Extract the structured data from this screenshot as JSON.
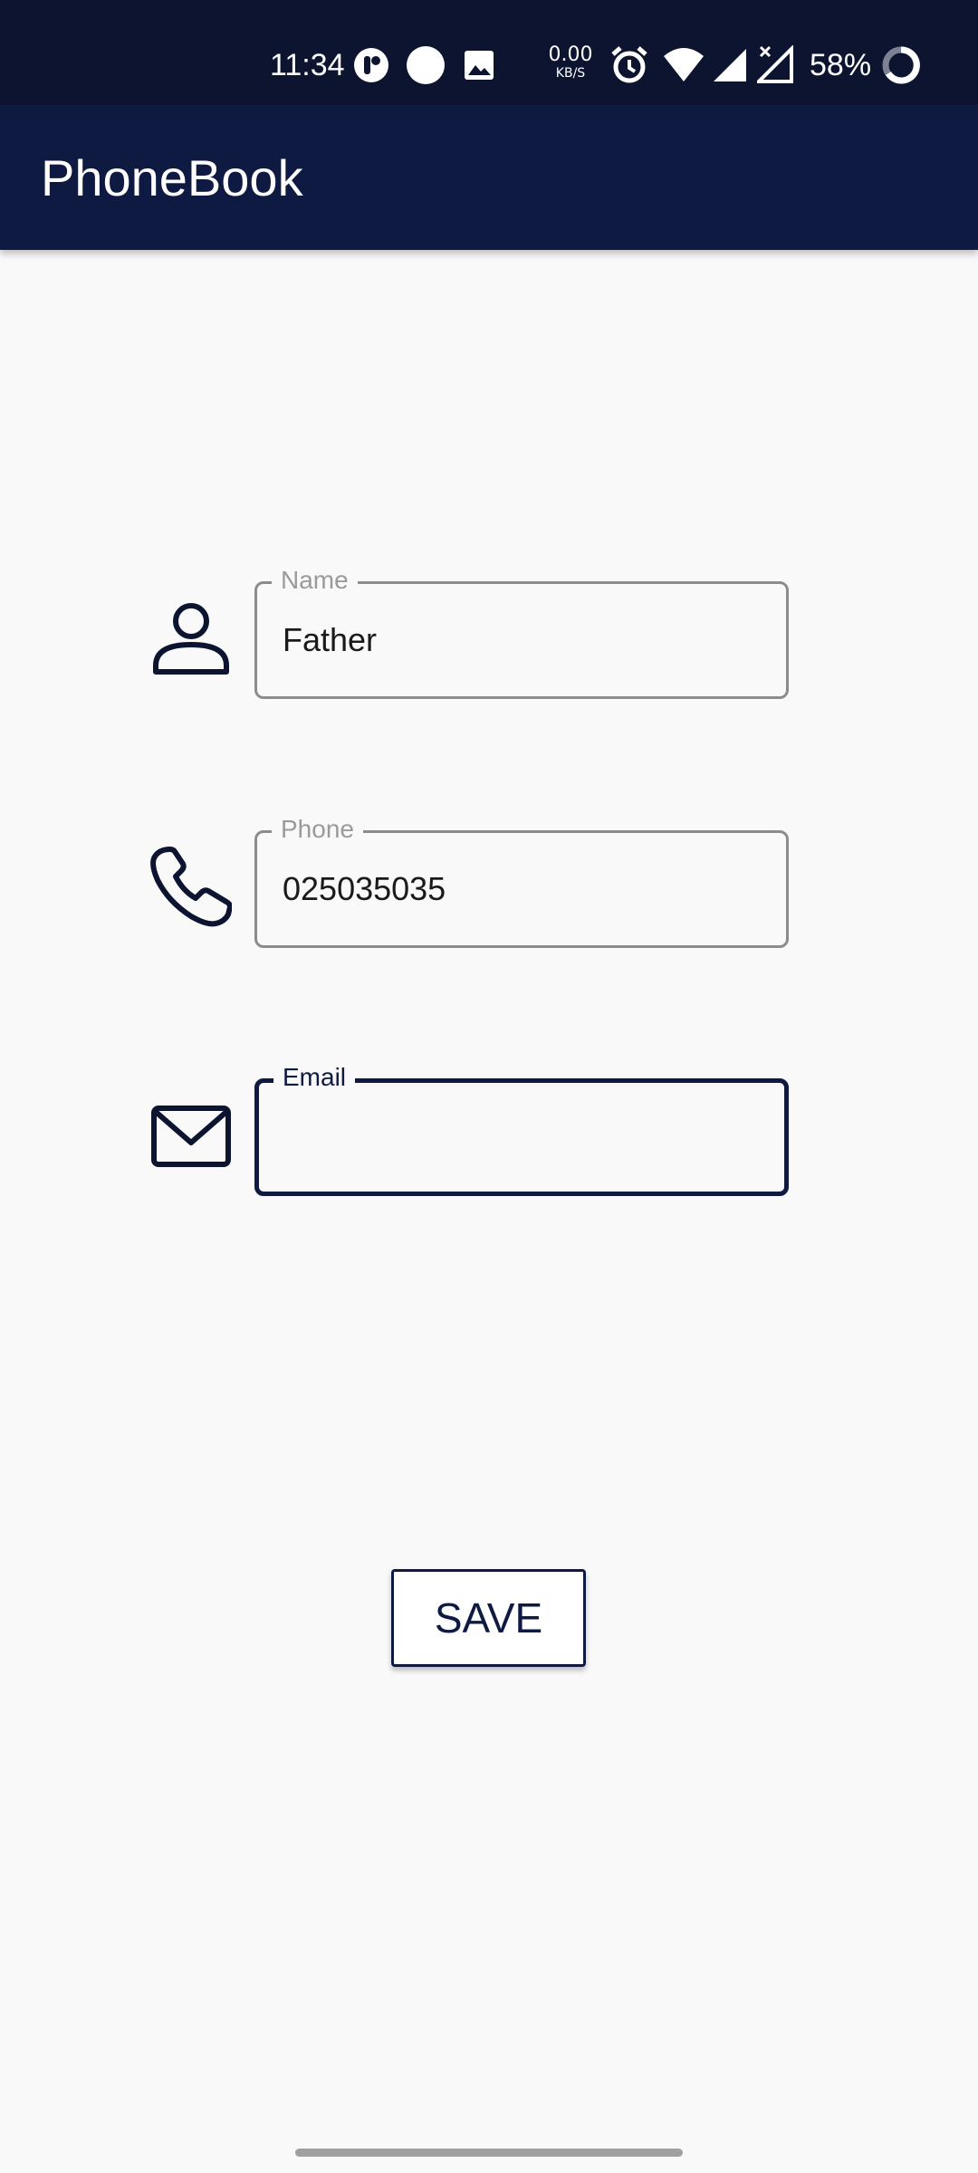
{
  "status_bar": {
    "time": "11:34",
    "net_speed_value": "0.00",
    "net_speed_unit": "KB/S",
    "battery": "58%",
    "icons": [
      "app-notification-icon",
      "circle-notification-icon",
      "image-notification-icon",
      "alarm-icon",
      "wifi-icon",
      "signal-icon",
      "signal-no-service-icon",
      "battery-icon"
    ]
  },
  "app_bar": {
    "title": "PhoneBook"
  },
  "form": {
    "name": {
      "label": "Name",
      "value": "Father",
      "icon": "person-icon"
    },
    "phone": {
      "label": "Phone",
      "value": "025035035",
      "icon": "phone-icon"
    },
    "email": {
      "label": "Email",
      "value": "",
      "icon": "mail-icon",
      "focused": true
    }
  },
  "save_label": "SAVE",
  "colors": {
    "status_bar": "#0c1430",
    "app_bar": "#0f1a42",
    "background": "#f9f9f9",
    "accent": "#0f1a42"
  }
}
